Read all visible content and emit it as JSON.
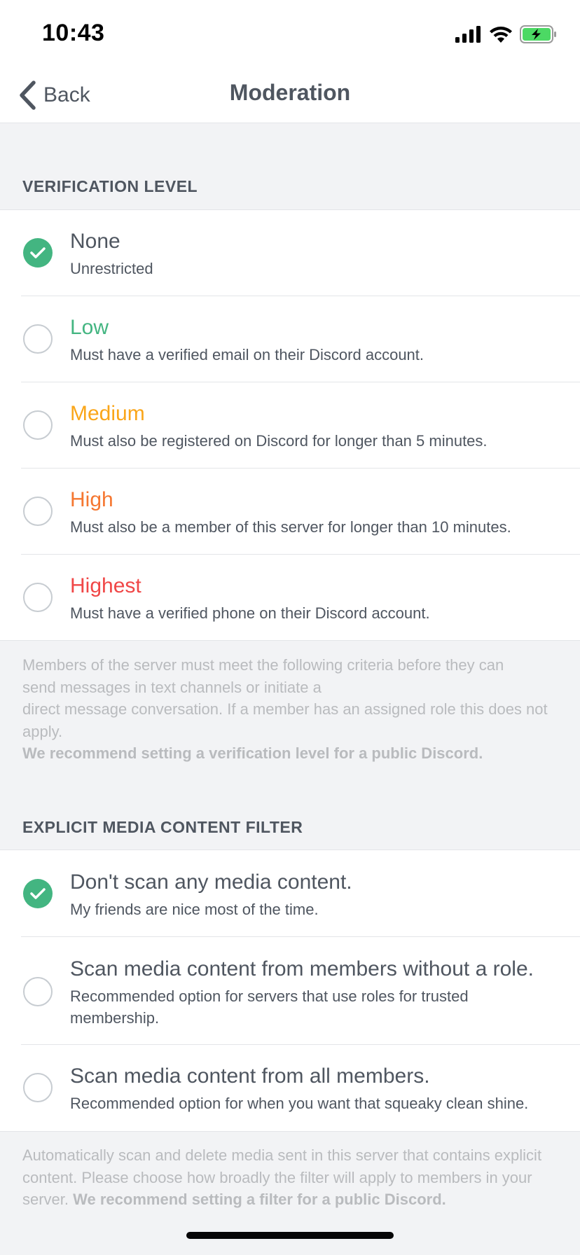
{
  "status_bar": {
    "time": "10:43",
    "icons": [
      "cellular-signal-icon",
      "wifi-icon",
      "battery-charging-icon"
    ]
  },
  "nav": {
    "back_label": "Back",
    "title": "Moderation"
  },
  "verification": {
    "header": "VERIFICATION LEVEL",
    "options": [
      {
        "title": "None",
        "desc": "Unrestricted",
        "color": "#4f5660",
        "selected": true
      },
      {
        "title": "Low",
        "desc": "Must have a verified email on their Discord account.",
        "color": "#43b581",
        "selected": false
      },
      {
        "title": "Medium",
        "desc": "Must also be registered on Discord for longer than 5 minutes.",
        "color": "#faa61a",
        "selected": false
      },
      {
        "title": "High",
        "desc": "Must also be a member of this server for longer than 10 minutes.",
        "color": "#f57731",
        "selected": false
      },
      {
        "title": "Highest",
        "desc": "Must have a verified phone on their Discord account.",
        "color": "#f04747",
        "selected": false
      }
    ],
    "note_line1": "Members of the server must meet the following criteria before they can",
    "note_line2": "send messages in text channels or initiate a",
    "note_line3": "direct message conversation. If a member has an assigned role this does not apply.",
    "note_bold": "We recommend setting a verification level for a public Discord."
  },
  "content_filter": {
    "header": "EXPLICIT MEDIA CONTENT FILTER",
    "options": [
      {
        "title": "Don't scan any media content.",
        "desc": "My friends are nice most of the time.",
        "selected": true
      },
      {
        "title": "Scan media content from members without a role.",
        "desc": "Recommended option for servers that use roles for trusted membership.",
        "selected": false
      },
      {
        "title": "Scan media content from all members.",
        "desc": "Recommended option for when you want that squeaky clean shine.",
        "selected": false
      }
    ],
    "note_text": "Automatically scan and delete media sent in this server that contains explicit content. Please choose how broadly the filter will apply to members in your server.",
    "note_bold": "We recommend setting a filter for a public Discord."
  },
  "colors": {
    "accent_green": "#43b581",
    "text_primary": "#4f5660",
    "text_muted": "#b9bbbe",
    "background": "#f2f3f5"
  }
}
